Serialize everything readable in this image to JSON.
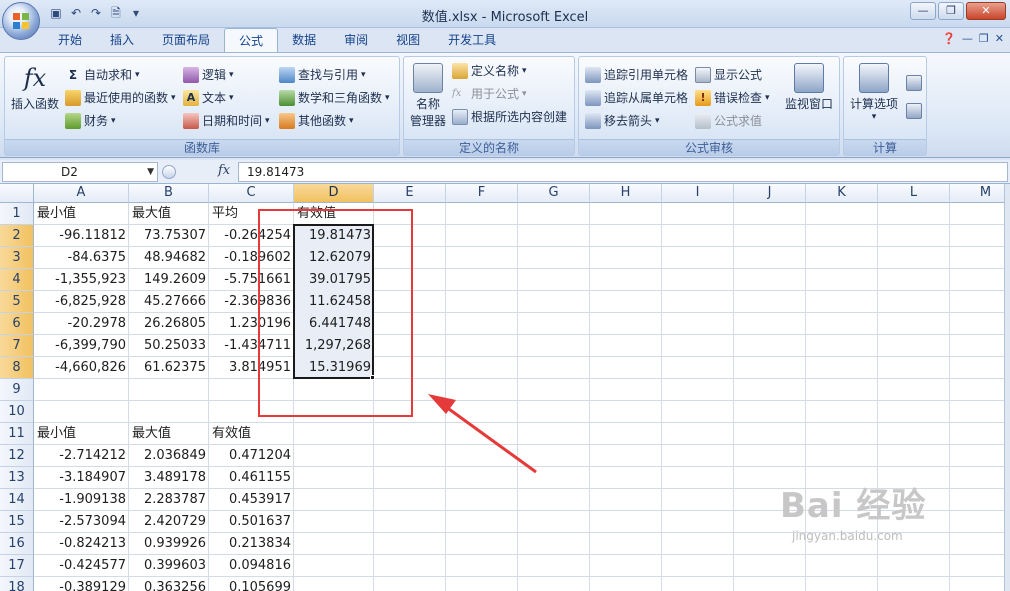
{
  "window": {
    "title": "数值.xlsx - Microsoft Excel"
  },
  "tabs": [
    {
      "label": "开始"
    },
    {
      "label": "插入"
    },
    {
      "label": "页面布局"
    },
    {
      "label": "公式"
    },
    {
      "label": "数据"
    },
    {
      "label": "审阅"
    },
    {
      "label": "视图"
    },
    {
      "label": "开发工具"
    }
  ],
  "ribbon": {
    "function_library": {
      "label": "函数库",
      "insert_function": "插入函数",
      "autosum": "自动求和",
      "recent": "最近使用的函数",
      "financial": "财务",
      "logical": "逻辑",
      "text": "文本",
      "datetime": "日期和时间",
      "lookup": "查找与引用",
      "math": "数学和三角函数",
      "more": "其他函数"
    },
    "defined_names": {
      "label": "定义的名称",
      "name_manager_1": "名称",
      "name_manager_2": "管理器",
      "define_name": "定义名称",
      "use_in_formula": "用于公式",
      "create_from_selection": "根据所选内容创建"
    },
    "formula_auditing": {
      "label": "公式审核",
      "trace_precedents": "追踪引用单元格",
      "trace_dependents": "追踪从属单元格",
      "remove_arrows": "移去箭头",
      "show_formulas": "显示公式",
      "error_checking": "错误检查",
      "evaluate_formula": "公式求值",
      "watch_window": "监视窗口"
    },
    "calculation": {
      "label": "计算",
      "options": "计算选项"
    }
  },
  "formula_bar": {
    "name_box": "D2",
    "fx": "fx",
    "value": "19.81473"
  },
  "columns": [
    "A",
    "B",
    "C",
    "D",
    "E",
    "F",
    "G",
    "H",
    "I",
    "J",
    "K",
    "L",
    "M"
  ],
  "rows": [
    "1",
    "2",
    "3",
    "4",
    "5",
    "6",
    "7",
    "8",
    "9",
    "10",
    "11",
    "12",
    "13",
    "14",
    "15",
    "16",
    "17",
    "18"
  ],
  "cells": {
    "r1": [
      "最小值",
      "最大值",
      "平均",
      "有效值"
    ],
    "r2": [
      "-96.11812",
      "73.75307",
      "-0.264254",
      "19.81473"
    ],
    "r3": [
      "-84.6375",
      "48.94682",
      "-0.189602",
      "12.62079"
    ],
    "r4": [
      "-1,355,923",
      "149.2609",
      "-5.751661",
      "39.01795"
    ],
    "r5": [
      "-6,825,928",
      "45.27666",
      "-2.369836",
      "11.62458"
    ],
    "r6": [
      "-20.2978",
      "26.26805",
      "1.230196",
      "6.441748"
    ],
    "r7": [
      "-6,399,790",
      "50.25033",
      "-1.434711",
      "1,297,268"
    ],
    "r8": [
      "-4,660,826",
      "61.62375",
      "3.814951",
      "15.31969"
    ],
    "r11": [
      "最小值",
      "最大值",
      "有效值"
    ],
    "r12": [
      "-2.714212",
      "2.036849",
      "0.471204"
    ],
    "r13": [
      "-3.184907",
      "3.489178",
      "0.461155"
    ],
    "r14": [
      "-1.909138",
      "2.283787",
      "0.453917"
    ],
    "r15": [
      "-2.573094",
      "2.420729",
      "0.501637"
    ],
    "r16": [
      "-0.824213",
      "0.939926",
      "0.213834"
    ],
    "r17": [
      "-0.424577",
      "0.399603",
      "0.094816"
    ],
    "r18": [
      "-0.389129",
      "0.363256",
      "0.105699"
    ]
  },
  "watermark": {
    "brand": "Bai 经验",
    "url": "jingyan.baidu.com"
  }
}
